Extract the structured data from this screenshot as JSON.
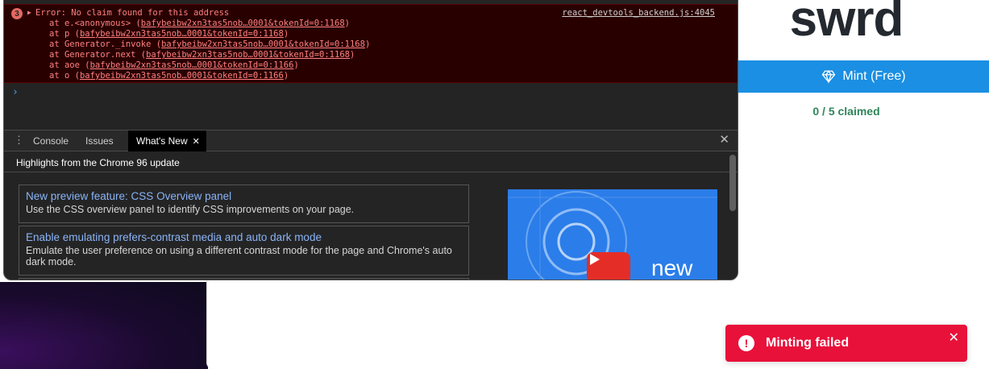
{
  "devtools": {
    "error": {
      "count": "3",
      "message": "Error: No claim found for this address",
      "source": "react_devtools_backend.js:4045",
      "trace": [
        {
          "prefix": "at e.<anonymous> (",
          "link": "bafybeibw2xn3tas5nob…0001&tokenId=0:1168",
          "suffix": ")"
        },
        {
          "prefix": "at p (",
          "link": "bafybeibw2xn3tas5nob…0001&tokenId=0:1168",
          "suffix": ")"
        },
        {
          "prefix": "at Generator._invoke (",
          "link": "bafybeibw2xn3tas5nob…0001&tokenId=0:1168",
          "suffix": ")"
        },
        {
          "prefix": "at Generator.next (",
          "link": "bafybeibw2xn3tas5nob…0001&tokenId=0:1168",
          "suffix": ")"
        },
        {
          "prefix": "at aoe (",
          "link": "bafybeibw2xn3tas5nob…0001&tokenId=0:1166",
          "suffix": ")"
        },
        {
          "prefix": "at o (",
          "link": "bafybeibw2xn3tas5nob…0001&tokenId=0:1166",
          "suffix": ")"
        }
      ],
      "prompt": "›"
    },
    "drawer": {
      "tabs": {
        "console": "Console",
        "issues": "Issues",
        "whats_new": "What's New"
      },
      "highlights_title": "Highlights from the Chrome 96 update",
      "features": [
        {
          "title": "New preview feature: CSS Overview panel",
          "description": "Use the CSS overview panel to identify CSS improvements on your page."
        },
        {
          "title": "Enable emulating prefers-contrast media and auto dark mode",
          "description": "Emulate the user preference on using a different contrast mode for the page and Chrome's auto dark mode."
        }
      ],
      "video_word": "new"
    }
  },
  "page": {
    "nft_title": "swrd",
    "mint_button": "Mint (Free)",
    "claimed_text": "0 / 5 claimed"
  },
  "toast": {
    "message": "Minting failed",
    "icon": "alert-icon"
  },
  "colors": {
    "mint_button": "#1a8fe3",
    "toast": "#e8113a",
    "claimed": "#2f855a",
    "error_bg": "#290000"
  }
}
